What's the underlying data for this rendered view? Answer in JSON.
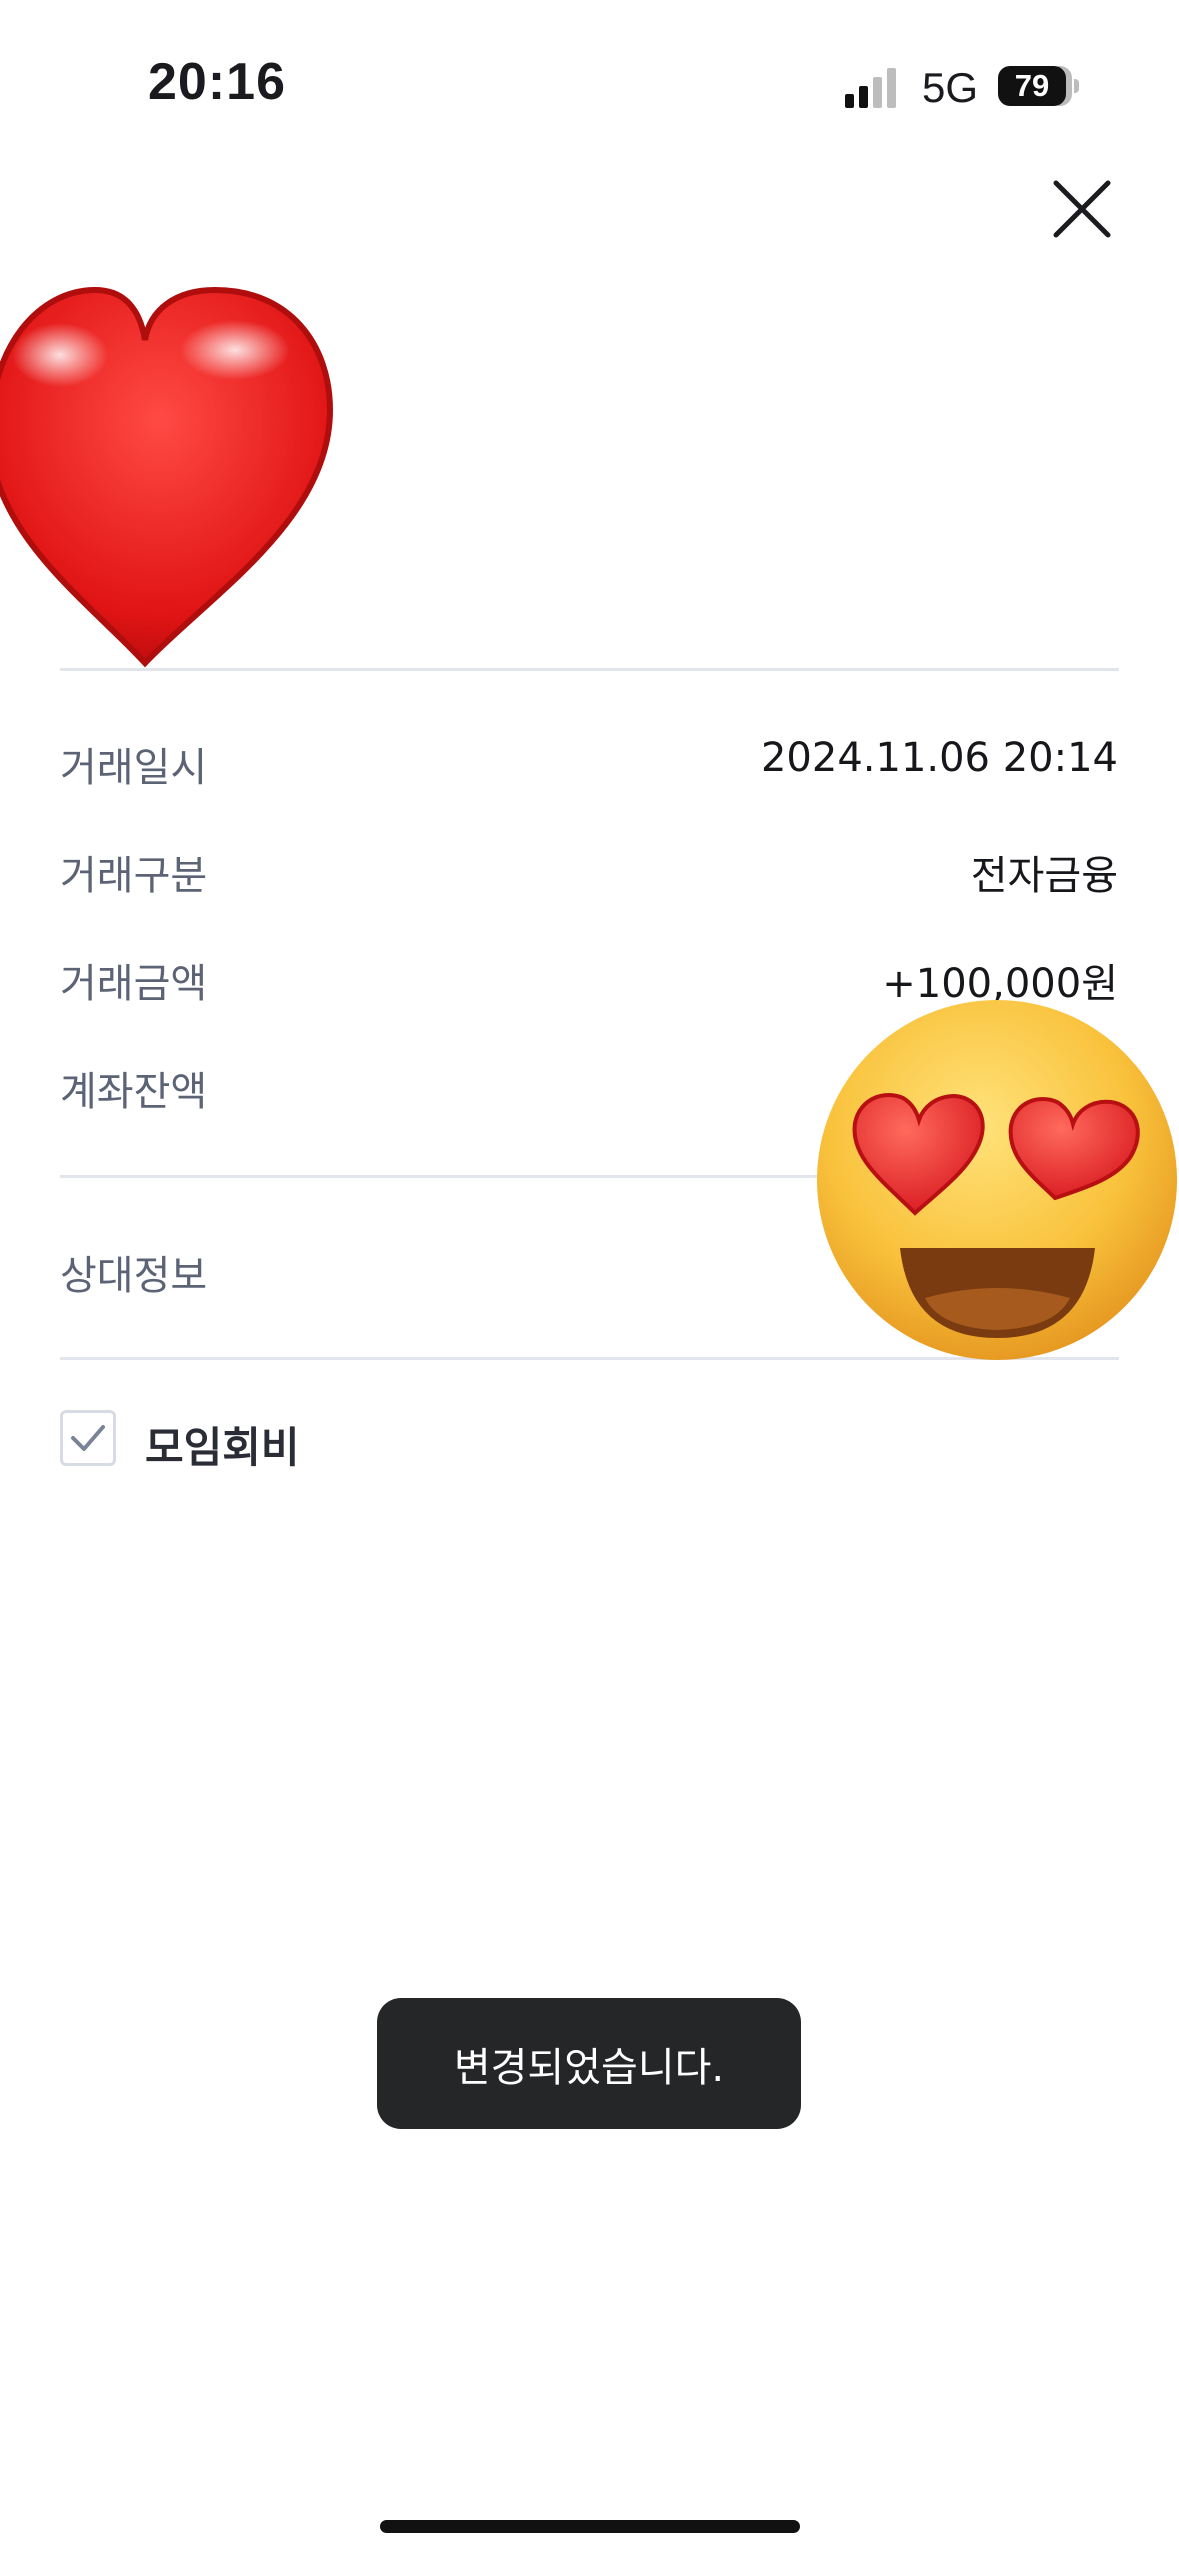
{
  "status_bar": {
    "time": "20:16",
    "network": "5G",
    "battery": "79"
  },
  "details": {
    "rows": [
      {
        "label": "거래일시",
        "value": "2024.11.06 20:14"
      },
      {
        "label": "거래구분",
        "value": "전자금융"
      },
      {
        "label": "거래금액",
        "value": "+100,000원"
      },
      {
        "label": "계좌잔액",
        "value": ""
      }
    ],
    "counterparty_label": "상대정보"
  },
  "category": {
    "label": "모임회비",
    "checked": true
  },
  "toast": {
    "message": "변경되었습니다."
  },
  "decorations": {
    "sticker_1": "red-heart-emoji",
    "sticker_2": "heart-eyes-emoji"
  },
  "colors": {
    "toast_bg": "#252627",
    "label": "#5c6375",
    "divider": "#e3e5ec"
  }
}
